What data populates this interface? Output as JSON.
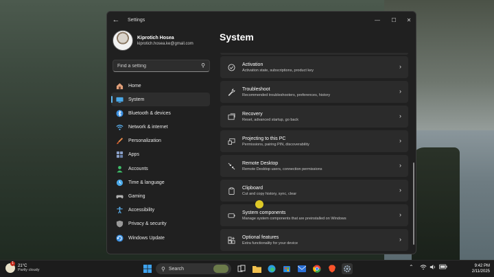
{
  "window": {
    "app_title": "Settings",
    "controls": [
      "minimize",
      "maximize",
      "close"
    ]
  },
  "profile": {
    "name": "Kiprotich Hosea",
    "email": "kiprotich.hosea.ke@gmail.com"
  },
  "search": {
    "placeholder": "Find a setting"
  },
  "sidebar": {
    "items": [
      {
        "label": "Home",
        "icon": "home-icon",
        "color": "#e0a07a"
      },
      {
        "label": "System",
        "icon": "monitor-icon",
        "color": "#4aa8e8"
      },
      {
        "label": "Bluetooth & devices",
        "icon": "bluetooth-icon",
        "color": "#3b8fe0"
      },
      {
        "label": "Network & internet",
        "icon": "wifi-icon",
        "color": "#5ab0f0"
      },
      {
        "label": "Personalization",
        "icon": "brush-icon",
        "color": "#e88a4a"
      },
      {
        "label": "Apps",
        "icon": "apps-icon",
        "color": "#8aa0c8"
      },
      {
        "label": "Accounts",
        "icon": "person-icon",
        "color": "#3fbf6a"
      },
      {
        "label": "Time & language",
        "icon": "globe-clock-icon",
        "color": "#4aa8e8"
      },
      {
        "label": "Gaming",
        "icon": "gamepad-icon",
        "color": "#b0b0b0"
      },
      {
        "label": "Accessibility",
        "icon": "accessibility-icon",
        "color": "#5ab0f0"
      },
      {
        "label": "Privacy & security",
        "icon": "shield-icon",
        "color": "#9a9a9a"
      },
      {
        "label": "Windows Update",
        "icon": "update-icon",
        "color": "#3b8fe0"
      }
    ],
    "active_index": 1
  },
  "main": {
    "title": "System",
    "items": [
      {
        "title": "Activation",
        "subtitle": "Activation state, subscriptions, product key",
        "icon": "check-circle-icon"
      },
      {
        "title": "Troubleshoot",
        "subtitle": "Recommended troubleshooters, preferences, history",
        "icon": "wrench-icon"
      },
      {
        "title": "Recovery",
        "subtitle": "Reset, advanced startup, go back",
        "icon": "recovery-icon"
      },
      {
        "title": "Projecting to this PC",
        "subtitle": "Permissions, pairing PIN, discoverability",
        "icon": "project-icon"
      },
      {
        "title": "Remote Desktop",
        "subtitle": "Remote Desktop users, connection permissions",
        "icon": "remote-desktop-icon"
      },
      {
        "title": "Clipboard",
        "subtitle": "Cut and copy history, sync, clear",
        "icon": "clipboard-icon"
      },
      {
        "title": "System components",
        "subtitle": "Manage system components that are preinstalled on Windows",
        "icon": "components-icon"
      },
      {
        "title": "Optional features",
        "subtitle": "Extra functionality for your device",
        "icon": "optional-features-icon"
      }
    ]
  },
  "taskbar": {
    "weather_temp": "21°C",
    "weather_cond": "Partly cloudy",
    "weather_badge": "1",
    "search_label": "Search",
    "time": "9:42 PM",
    "date": "2/11/2025"
  }
}
